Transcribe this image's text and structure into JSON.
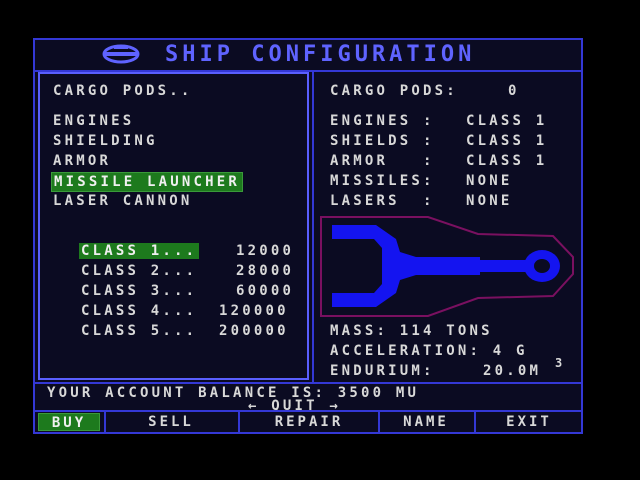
{
  "title": "SHIP CONFIGURATION",
  "logo_icon": "ship-emblem-icon",
  "left_menu": {
    "cargo_pods": "CARGO PODS..",
    "items": [
      "ENGINES",
      "SHIELDING",
      "ARMOR",
      "MISSILE LAUNCHER",
      "LASER CANNON"
    ],
    "selected": "MISSILE LAUNCHER"
  },
  "price_list": [
    {
      "label": "CLASS 1...",
      "price": "12000",
      "selected": true
    },
    {
      "label": "CLASS 2...",
      "price": "28000"
    },
    {
      "label": "CLASS 3...",
      "price": "60000"
    },
    {
      "label": "CLASS 4...",
      "price": "120000"
    },
    {
      "label": "CLASS 5...",
      "price": "200000"
    }
  ],
  "status": {
    "cargo_pods": {
      "label": "CARGO PODS:",
      "value": "0"
    },
    "engines": {
      "label": "ENGINES :",
      "value": "CLASS 1"
    },
    "shields": {
      "label": "SHIELDS :",
      "value": "CLASS 1"
    },
    "armor": {
      "label": "ARMOR   :",
      "value": "CLASS 1"
    },
    "missiles": {
      "label": "MISSILES:",
      "value": "NONE"
    },
    "lasers": {
      "label": "LASERS  :",
      "value": "NONE"
    }
  },
  "stats": {
    "mass": "MASS: 114 TONS",
    "acceleration": "ACCELERATION: 4 G",
    "endurium_label": "ENDURIUM:",
    "endurium_value": "20.0M",
    "endurium_sup": "3"
  },
  "balance": "YOUR ACCOUNT BALANCE IS: 3500 MU",
  "quit": "← QUIT →",
  "buttons": {
    "buy": "BUY",
    "sell": "SELL",
    "repair": "REPAIR",
    "name": "NAME",
    "exit": "EXIT"
  },
  "colors": {
    "frame": "#3438d6",
    "title": "#5f63ff",
    "highlight": "#1d7a1d",
    "ship": "#1414f0",
    "ship_outline": "#7a1060"
  }
}
